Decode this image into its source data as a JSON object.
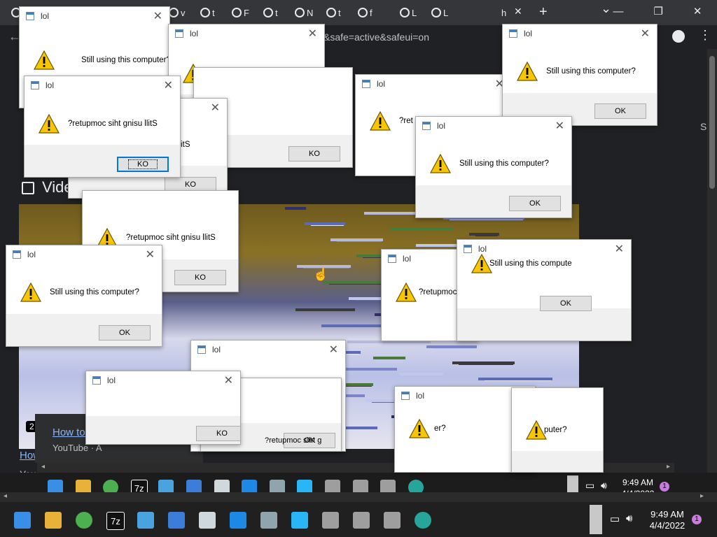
{
  "browser": {
    "tabs": [
      {
        "icon": "google-icon",
        "label": ""
      },
      {
        "icon": "google-icon",
        "label": ""
      },
      {
        "icon": "google-icon",
        "label": ""
      },
      {
        "icon": "google-icon",
        "label": ""
      },
      {
        "icon": "google-icon",
        "label": "F"
      },
      {
        "icon": "google-icon",
        "label": "v"
      },
      {
        "icon": "google-icon",
        "label": "t"
      },
      {
        "icon": "google-icon",
        "label": "F"
      },
      {
        "icon": "google-icon",
        "label": "t"
      },
      {
        "icon": "github-icon",
        "label": "N"
      },
      {
        "icon": "google-icon",
        "label": "t"
      },
      {
        "icon": "google-icon",
        "label": "f"
      },
      {
        "icon": "loading-icon",
        "label": "L"
      },
      {
        "icon": "loading-icon",
        "label": "L"
      },
      {
        "icon": "",
        "label": "h"
      }
    ],
    "active_tab_close": "✕",
    "new_tab": "+",
    "dropdown": "⌄",
    "window_controls": {
      "minimize": "—",
      "maximize": "❐",
      "close": "✕"
    },
    "address_fragment": "&safe=active&safeui=on",
    "back": "←"
  },
  "page": {
    "section_title": "Vide",
    "side_fragment": "S",
    "video_link": "How",
    "video_source": "You",
    "popup_link": "How to dow",
    "popup_source": "YouTube · A",
    "duration_badge": "2"
  },
  "dialog_title": "lol",
  "close_glyph": "✕",
  "dialogs": [
    {
      "msg": "Still using this computer?",
      "btn": "OK"
    },
    {
      "msg": "?retupmoc siht gnisu llitS",
      "btn": "KO"
    },
    {
      "msg": "?retupmoc siht gnisu llitS",
      "btn": "KO"
    },
    {
      "msg": "llitS",
      "btn": "KO"
    },
    {
      "msg": "?retupmoc siht gnisu llitS",
      "btn": "KO"
    },
    {
      "msg": "?ret",
      "btn": ""
    },
    {
      "msg": "Still using this computer?",
      "btn": "OK"
    },
    {
      "msg": "Still using this computer?",
      "btn": "OK"
    },
    {
      "msg": "?retupmoc siht gnisu llitS",
      "btn": "KO"
    },
    {
      "msg": "Still using this computer?",
      "btn": "OK"
    },
    {
      "msg": "?retupmoc s",
      "btn": ""
    },
    {
      "msg": "Still using this compute",
      "btn": "OK"
    },
    {
      "msg": "",
      "btn": "OK"
    },
    {
      "msg": "",
      "btn": "OK"
    },
    {
      "msg": "?retupmoc siht gnisu llitS",
      "btn": "KO"
    },
    {
      "msg": "er?",
      "btn": ""
    },
    {
      "msg": "puter?",
      "btn": "OK"
    }
  ],
  "behind_text": "?retupmoc siht g",
  "taskbar": {
    "apps": [
      "windows-start-icon",
      "file-explorer-icon",
      "chrome-icon",
      "7zip-icon",
      "notepad-icon",
      "photos-icon",
      "paint-icon",
      "window-icon",
      "calculator-icon",
      "control-panel-icon",
      "computer-icon",
      "computer-icon",
      "computer-icon",
      "globe-icon"
    ],
    "zip_label": "7z",
    "time": "9:49 AM",
    "date": "4/4/2022",
    "badge": "1"
  }
}
